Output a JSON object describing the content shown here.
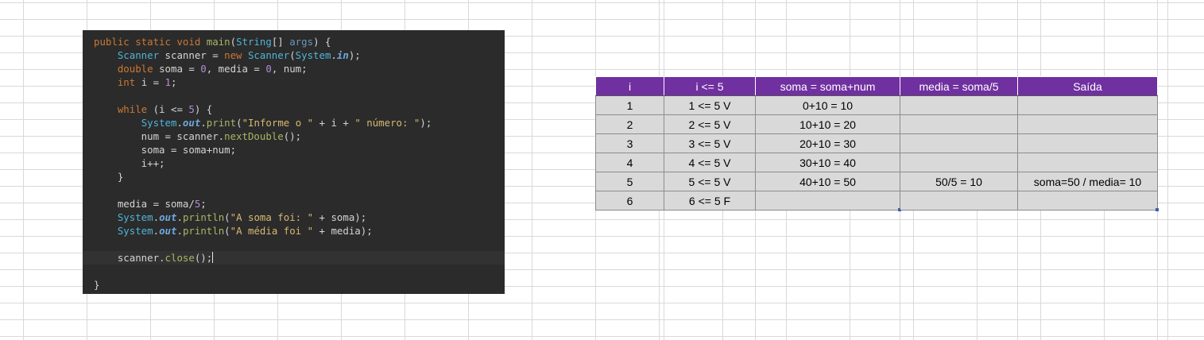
{
  "code": {
    "lines": [
      [
        {
          "t": "public static void ",
          "c": "kw"
        },
        {
          "t": "main",
          "c": "fn"
        },
        {
          "t": "(",
          "c": "pl"
        },
        {
          "t": "String",
          "c": "cls"
        },
        {
          "t": "[] ",
          "c": "pl"
        },
        {
          "t": "args",
          "c": "ty"
        },
        {
          "t": ") {",
          "c": "pl"
        }
      ],
      [
        {
          "t": "    ",
          "c": "pl"
        },
        {
          "t": "Scanner",
          "c": "cls"
        },
        {
          "t": " scanner = ",
          "c": "pl"
        },
        {
          "t": "new ",
          "c": "kw"
        },
        {
          "t": "Scanner",
          "c": "cls"
        },
        {
          "t": "(",
          "c": "pl"
        },
        {
          "t": "System",
          "c": "cls"
        },
        {
          "t": ".",
          "c": "pl"
        },
        {
          "t": "in",
          "c": "fld"
        },
        {
          "t": ");",
          "c": "pl"
        }
      ],
      [
        {
          "t": "    ",
          "c": "pl"
        },
        {
          "t": "double ",
          "c": "kw"
        },
        {
          "t": "soma = ",
          "c": "pl"
        },
        {
          "t": "0",
          "c": "num"
        },
        {
          "t": ", media = ",
          "c": "pl"
        },
        {
          "t": "0",
          "c": "num"
        },
        {
          "t": ", num;",
          "c": "pl"
        }
      ],
      [
        {
          "t": "    ",
          "c": "pl"
        },
        {
          "t": "int ",
          "c": "kw"
        },
        {
          "t": "i = ",
          "c": "pl"
        },
        {
          "t": "1",
          "c": "num"
        },
        {
          "t": ";",
          "c": "pl"
        }
      ],
      [],
      [
        {
          "t": "    ",
          "c": "pl"
        },
        {
          "t": "while ",
          "c": "kw"
        },
        {
          "t": "(i <= ",
          "c": "pl"
        },
        {
          "t": "5",
          "c": "num"
        },
        {
          "t": ") {",
          "c": "pl"
        }
      ],
      [
        {
          "t": "        ",
          "c": "pl"
        },
        {
          "t": "System",
          "c": "cls"
        },
        {
          "t": ".",
          "c": "pl"
        },
        {
          "t": "out",
          "c": "fld"
        },
        {
          "t": ".",
          "c": "pl"
        },
        {
          "t": "print",
          "c": "fn"
        },
        {
          "t": "(",
          "c": "pl"
        },
        {
          "t": "\"Informe o \"",
          "c": "str"
        },
        {
          "t": " + i + ",
          "c": "pl"
        },
        {
          "t": "\" número: \"",
          "c": "str"
        },
        {
          "t": ");",
          "c": "pl"
        }
      ],
      [
        {
          "t": "        num = scanner.",
          "c": "pl"
        },
        {
          "t": "nextDouble",
          "c": "fn"
        },
        {
          "t": "();",
          "c": "pl"
        }
      ],
      [
        {
          "t": "        soma = soma+num;",
          "c": "pl"
        }
      ],
      [
        {
          "t": "        i++;",
          "c": "pl"
        }
      ],
      [
        {
          "t": "    }",
          "c": "pl"
        }
      ],
      [],
      [
        {
          "t": "    media = soma/",
          "c": "pl"
        },
        {
          "t": "5",
          "c": "num"
        },
        {
          "t": ";",
          "c": "pl"
        }
      ],
      [
        {
          "t": "    ",
          "c": "pl"
        },
        {
          "t": "System",
          "c": "cls"
        },
        {
          "t": ".",
          "c": "pl"
        },
        {
          "t": "out",
          "c": "fld"
        },
        {
          "t": ".",
          "c": "pl"
        },
        {
          "t": "println",
          "c": "fn"
        },
        {
          "t": "(",
          "c": "pl"
        },
        {
          "t": "\"A soma foi: \"",
          "c": "str"
        },
        {
          "t": " + soma);",
          "c": "pl"
        }
      ],
      [
        {
          "t": "    ",
          "c": "pl"
        },
        {
          "t": "System",
          "c": "cls"
        },
        {
          "t": ".",
          "c": "pl"
        },
        {
          "t": "out",
          "c": "fld"
        },
        {
          "t": ".",
          "c": "pl"
        },
        {
          "t": "println",
          "c": "fn"
        },
        {
          "t": "(",
          "c": "pl"
        },
        {
          "t": "\"A média foi \"",
          "c": "str"
        },
        {
          "t": " + media);",
          "c": "pl"
        }
      ],
      [],
      [
        {
          "t": "    scanner.",
          "c": "pl"
        },
        {
          "t": "close",
          "c": "fn"
        },
        {
          "t": "();",
          "c": "pl"
        }
      ],
      [],
      [
        {
          "t": "}",
          "c": "pl"
        }
      ]
    ],
    "current_line": 16
  },
  "table": {
    "headers": [
      "i",
      "i <= 5",
      "soma = soma+num",
      "media = soma/5",
      "Saída"
    ],
    "rows": [
      [
        "1",
        "1 <= 5  V",
        "0+10 = 10",
        "",
        ""
      ],
      [
        "2",
        "2 <= 5  V",
        "10+10 = 20",
        "",
        ""
      ],
      [
        "3",
        "3 <= 5  V",
        "20+10 = 30",
        "",
        ""
      ],
      [
        "4",
        "4 <= 5  V",
        "30+10 = 40",
        "",
        ""
      ],
      [
        "5",
        "5 <= 5  V",
        "40+10 = 50",
        "50/5 = 10",
        "soma=50 / media= 10"
      ],
      [
        "6",
        "6 <= 5  F",
        "",
        "",
        ""
      ]
    ]
  }
}
